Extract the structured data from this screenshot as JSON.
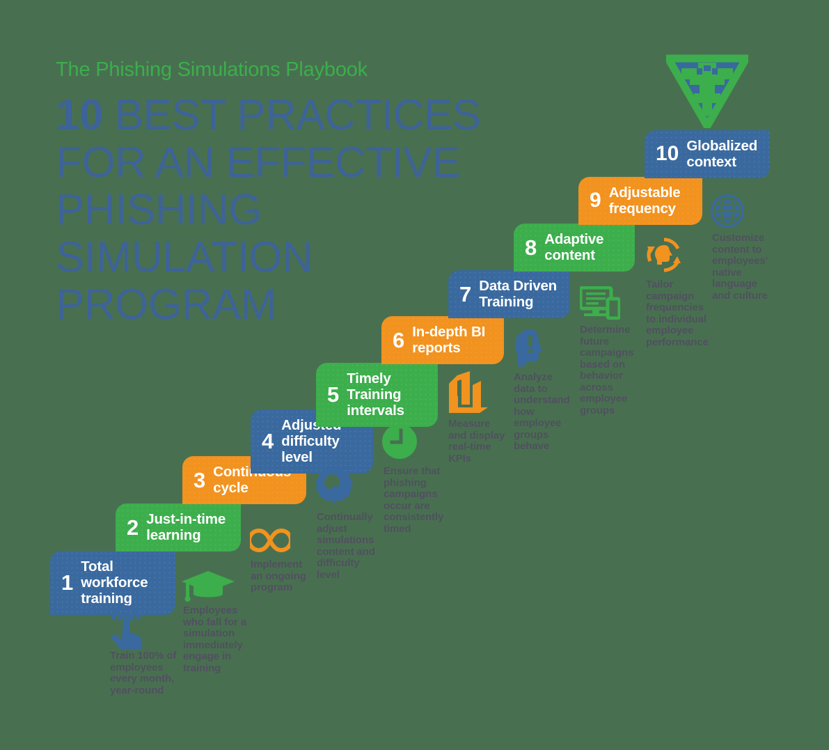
{
  "meta": {
    "background_color": "#487050",
    "blue": "#39699e",
    "green": "#3cae4c",
    "orange": "#f2921f",
    "heading_color": "#3d6398",
    "caption_color": "#50505f"
  },
  "header": {
    "kicker": "The Phishing Simulations Playbook",
    "headline_number": "10",
    "headline_rest": " BEST PRACTICES FOR AN EFFECTIVE PHISHING SIMULATION PROGRAM"
  },
  "logo": {
    "name": "superhero-shield-logo"
  },
  "steps": [
    {
      "number": "1",
      "label": "Total workforce training",
      "color": "blue",
      "icon": "tap-gesture-icon",
      "icon_color": "blue",
      "caption": "Train 100% of employees every month, year-round"
    },
    {
      "number": "2",
      "label": "Just-in-time learning",
      "color": "green",
      "icon": "graduation-cap-icon",
      "icon_color": "green",
      "caption": "Employees who fall for a simulation immediately engage in training"
    },
    {
      "number": "3",
      "label": "Continuous cycle",
      "color": "orange",
      "icon": "infinity-icon",
      "icon_color": "orange",
      "caption": "Implement an ongoing program"
    },
    {
      "number": "4",
      "label": "Adjusted difficulty level",
      "color": "blue",
      "icon": "gear-settings-icon",
      "icon_color": "blue",
      "caption": "Continually adjust simulations content and difficulty level"
    },
    {
      "number": "5",
      "label": "Timely Training intervals",
      "color": "green",
      "icon": "clock-icon",
      "icon_color": "green",
      "caption": "Ensure that phishing campaigns occur are consistently timed"
    },
    {
      "number": "6",
      "label": "In-depth BI reports",
      "color": "orange",
      "icon": "bar-chart-icon",
      "icon_color": "orange",
      "caption": "Measure and display real-time KPIs"
    },
    {
      "number": "7",
      "label": "Data Driven Training",
      "color": "blue",
      "icon": "head-insight-icon",
      "icon_color": "blue",
      "caption": "Analyze data to understand how employee groups behave"
    },
    {
      "number": "8",
      "label": "Adaptive content",
      "color": "green",
      "icon": "responsive-devices-icon",
      "icon_color": "green",
      "caption": "Determine future campaigns based on behavior across employee groups"
    },
    {
      "number": "9",
      "label": "Adjustable frequency",
      "color": "orange",
      "icon": "head-cycle-icon",
      "icon_color": "orange",
      "caption": "Tailor campaign frequencies to individual employee performance"
    },
    {
      "number": "10",
      "label": "Globalized context",
      "color": "blue",
      "icon": "globe-icon",
      "icon_color": "blue",
      "caption": "Customize content to employees' native language and culture"
    }
  ]
}
